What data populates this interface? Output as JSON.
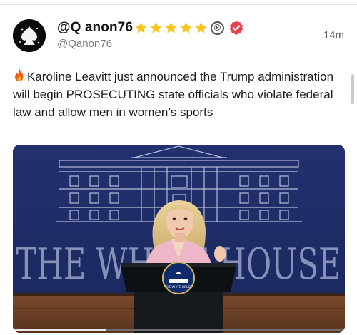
{
  "post": {
    "display_name": "@Q anon76",
    "handle": "@Qanon76",
    "time": "14m",
    "badges": {
      "stars": 5,
      "star_icon": "star-icon",
      "registered_symbol": "®",
      "verified_icon": "verified-badge-icon"
    },
    "text": "Karoline Leavitt just announced the Trump administration will begin PROSECUTING state officials who violate federal law and allow men in women’s sports",
    "text_icon": "fire-icon",
    "media": {
      "backdrop_text": "THE WHITE HOUSE",
      "podium_seal": "THE WHITE HOUSE",
      "video_progress": 0.28
    }
  },
  "colors": {
    "star": "#f5c518",
    "verified": "#e8424f",
    "backdrop": "#1d2c6b",
    "handle": "#7a7a80"
  }
}
